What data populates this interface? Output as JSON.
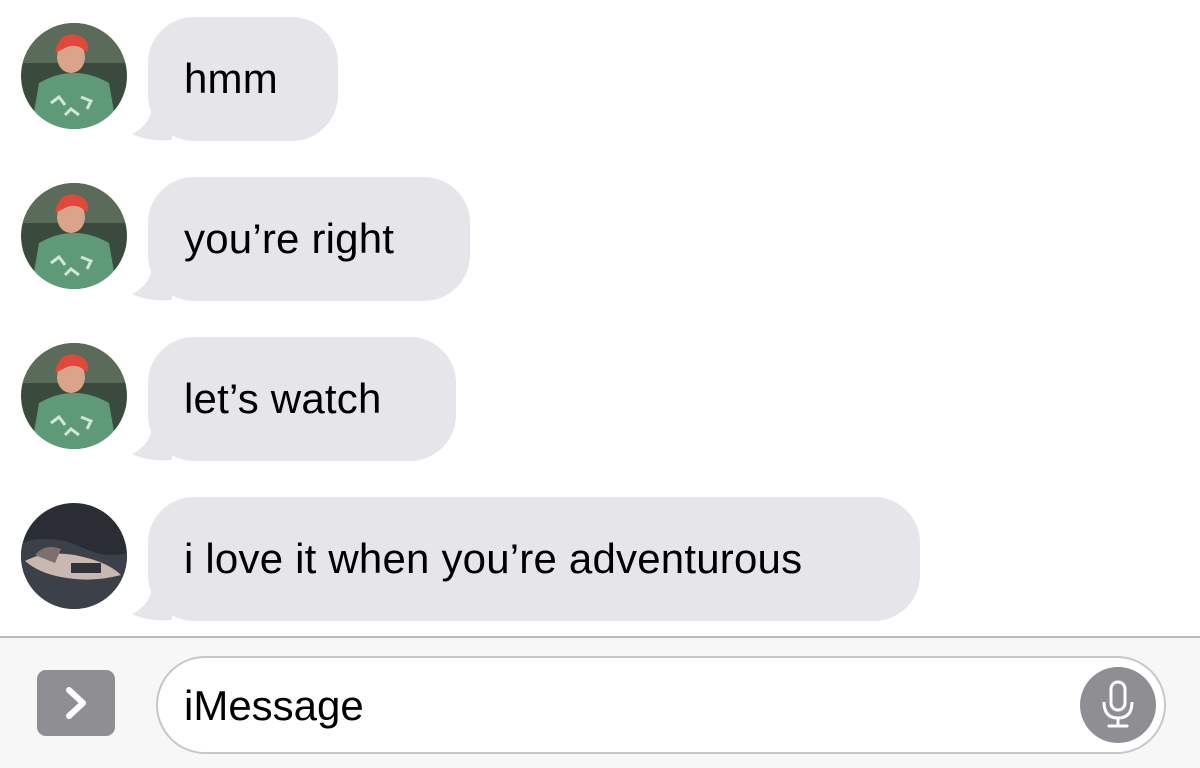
{
  "messages": [
    {
      "text": "hmm",
      "avatar_icon": "avatar-red-hair-icon"
    },
    {
      "text": "you’re right",
      "avatar_icon": "avatar-red-hair-icon"
    },
    {
      "text": "let’s watch",
      "avatar_icon": "avatar-red-hair-icon"
    },
    {
      "text": "i love it when you’re adventurous",
      "avatar_icon": "avatar-dark-icon"
    }
  ],
  "compose": {
    "placeholder": "iMessage",
    "apps_icon": "chevron-right-icon",
    "mic_icon": "microphone-icon"
  },
  "colors": {
    "bubble_gray": "#e5e5ea",
    "button_gray": "#8e8e93",
    "compose_background": "#f7f7f7"
  }
}
